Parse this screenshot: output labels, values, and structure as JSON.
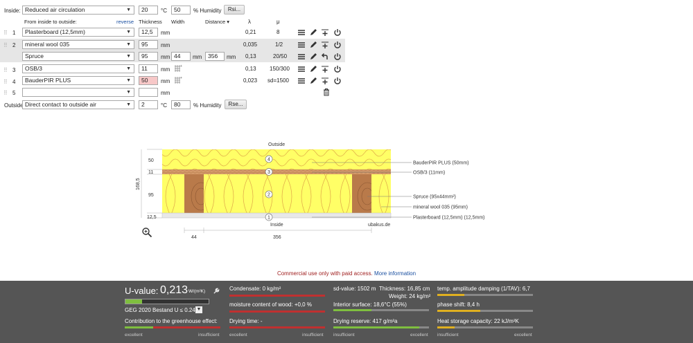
{
  "inside": {
    "label": "Inside:",
    "climate": "Reduced air circulation",
    "temp": "20",
    "temp_unit": "°C",
    "humidity": "50",
    "humidity_unit": "% Humidity",
    "button": "Rsi..."
  },
  "header": {
    "from_label": "From inside to outside:",
    "reverse": "reverse",
    "thickness": "Thickness",
    "width": "Width",
    "distance": "Distance",
    "lambda": "λ",
    "mu": "μ"
  },
  "layers": [
    {
      "num": "1",
      "material": "Plasterboard (12,5mm)",
      "thickness": "12,5",
      "unit": "mm",
      "lambda": "0,21",
      "mu": "8"
    },
    {
      "num": "2",
      "material": "mineral wool 035",
      "thickness": "95",
      "unit": "mm",
      "lambda": "0,035",
      "mu": "1/2"
    },
    {
      "num": "",
      "material": "Spruce",
      "thickness": "95",
      "unit": "mm",
      "width": "44",
      "width_unit": "mm",
      "distance": "356",
      "distance_unit": "mm",
      "lambda": "0,13",
      "mu": "20/50"
    },
    {
      "num": "3",
      "material": "OSB/3",
      "thickness": "11",
      "unit": "mm",
      "lambda": "0,13",
      "mu": "150/300"
    },
    {
      "num": "4",
      "material": "BauderPIR PLUS",
      "thickness": "50",
      "unit": "mm",
      "lambda": "0,023",
      "mu": "sd=1500"
    },
    {
      "num": "5",
      "material": "",
      "thickness": "",
      "unit": "mm",
      "lambda": "",
      "mu": ""
    }
  ],
  "outside": {
    "label": "Outside",
    "climate": "Direct contact to outside air",
    "temp": "2",
    "temp_unit": "°C",
    "humidity": "80",
    "humidity_unit": "% Humidity",
    "button": "Rse..."
  },
  "diagram": {
    "outside": "Outside",
    "inside": "Inside",
    "watermark": "ubakus.de",
    "total": "168,5",
    "dims": [
      "50",
      "11",
      "95",
      "12,5"
    ],
    "bottom_dims": [
      "44",
      "356"
    ],
    "callouts": [
      "BauderPIR PLUS (50mm)",
      "OSB/3 (11mm)",
      "Spruce (95x44mm²)",
      "mineral wool 035 (95mm)",
      "Plasterboard (12,5mm) (12,5mm)"
    ],
    "circles": [
      "4",
      "3",
      "2",
      "1"
    ]
  },
  "notice": {
    "text": "Commercial use only with paid access.",
    "link": "More information"
  },
  "footer": {
    "uvalue_label": "U-value:",
    "uvalue": "0,213",
    "uvalue_unit": "W/(m²K)",
    "geg": "GEG 2020 Bestand U ≤ 0.24",
    "greenhouse": "Contribution to the greenhouse effect:",
    "condensate": "Condensate: 0 kg/m²",
    "moisture": "moisture content of wood: +0,0 %",
    "drying_time": "Drying time: -",
    "sd_value": "sd-value: 1502 m",
    "thickness": "Thickness: 16,85 cm",
    "weight": "Weight: 24 kg/m²",
    "interior_surface": "Interior surface: 18,6°C (55%)",
    "drying_reserve": "Drying reserve: 417 g/m²a",
    "amplitude": "temp. amplitude damping (1/TAV): 6,7",
    "phase": "phase shift: 8,4 h",
    "heat_storage": "Heat storage capacity: 22 kJ/m²K",
    "excellent": "excellent",
    "insufficient": "insufficient",
    "uvalue_fill_pct": 20,
    "greenhouse_fill_pct": 30,
    "interior_fill_pct": 40,
    "drying_reserve_fill_pct": 90,
    "amplitude_fill_pct": 28,
    "phase_fill_pct": 45,
    "heat_fill_pct": 18
  },
  "colors": {
    "footer_bg": "#555555",
    "good": "#7fbf3f",
    "bad": "#c03030",
    "warn": "#e0b020",
    "insulation": "#ffff66",
    "wood": "#b97a4a",
    "link": "#1a4fa0",
    "notice": "#a02020"
  }
}
